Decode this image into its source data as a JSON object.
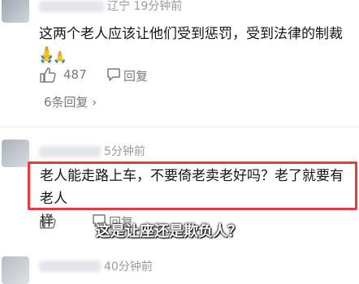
{
  "comment1": {
    "meta": "辽宁 19分钟前",
    "text_line1": "这两个老人应该让他们受到惩罚，受到法律的制裁",
    "emoji_inline": "🙏🙏",
    "emoji_line2": "🙏",
    "like_count": "487",
    "reply_label": "回复",
    "replies_link": "6条回复 ›"
  },
  "comment2": {
    "meta": "5分钟前",
    "text_line1": "老人能走路上车，不要倚老卖老好吗？老了就要有老人",
    "text_line2": "样",
    "reply_label": "回复"
  },
  "comment3": {
    "meta": "40分钟前"
  },
  "subtitle": "这是让座还是欺负人？",
  "colors": {
    "highlight_border": "#e53a40",
    "meta_gray": "#9a9a9a"
  },
  "icons": [
    "thumbs-up-icon",
    "chat-bubble-icon"
  ]
}
